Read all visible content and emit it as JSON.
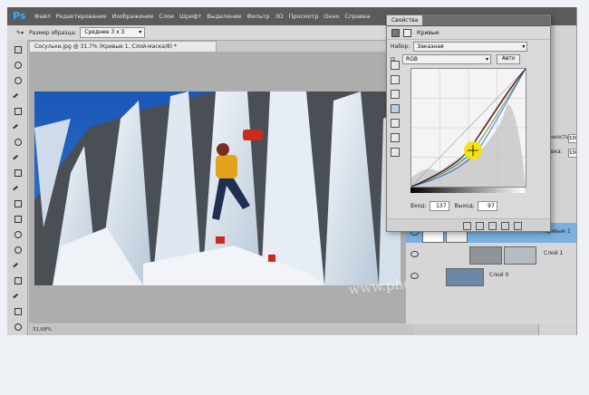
{
  "app": {
    "logo": "Ps"
  },
  "menu": [
    "Файл",
    "Редактирование",
    "Изображение",
    "Слои",
    "Шрифт",
    "Выделение",
    "Фильтр",
    "3D",
    "Просмотр",
    "Окно",
    "Справка"
  ],
  "options_bar": {
    "sample_size_label": "Размер образца:",
    "sample_size_value": "Среднее 3 х 3"
  },
  "document": {
    "tab_title": "Сосульки.jpg @ 31,7% (Кривые 1, Слой-маска/8) *",
    "status": "31,68%"
  },
  "properties": {
    "panel_tab": "Свойства",
    "title": "Кривые",
    "preset_label": "Набор:",
    "preset_value": "Заказная",
    "channel_value": "RGB",
    "auto_button": "Авто",
    "input_label": "Вход:",
    "input_value": "137",
    "output_label": "Выход:",
    "output_value": "97"
  },
  "right_panel": {
    "fx_label": "фх",
    "opacity_label": "зрачность:",
    "opacity_value": "100%",
    "fill_label": "аливка:",
    "fill_value": "100%"
  },
  "layers": [
    {
      "name": "Кривые 1",
      "selected": true
    },
    {
      "name": "Слой 1",
      "selected": false
    },
    {
      "name": "Слой 0",
      "selected": false
    }
  ],
  "watermark": "www.photoshopsunduchok"
}
